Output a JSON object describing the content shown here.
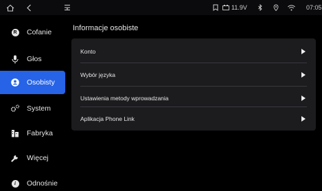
{
  "status_bar": {
    "home_icon": "home-icon",
    "back_icon": "back-icon",
    "menu_icon": "menu-icon",
    "voltage": "11.9V",
    "time": "07:05"
  },
  "sidebar": {
    "items": [
      {
        "label": "Cofanie",
        "icon": "reverse-icon",
        "active": false
      },
      {
        "label": "Głos",
        "icon": "microphone-icon",
        "active": false
      },
      {
        "label": "Osobisty",
        "icon": "user-icon",
        "active": true
      },
      {
        "label": "System",
        "icon": "gears-icon",
        "active": false
      },
      {
        "label": "Fabryka",
        "icon": "factory-icon",
        "active": false
      },
      {
        "label": "Więcej",
        "icon": "wrench-icon",
        "active": false
      },
      {
        "label": "Odnośnie",
        "icon": "info-icon",
        "active": false
      }
    ]
  },
  "main": {
    "title": "Informacje osobiste",
    "rows": [
      {
        "label": "Konto"
      },
      {
        "label": "Wybór języka"
      },
      {
        "label": "Ustawienia metody wprowadzania"
      },
      {
        "label": "Aplikacja Phone Link"
      }
    ]
  },
  "colors": {
    "accent": "#2663e6",
    "panel": "#1c1c1f",
    "background": "#000000"
  }
}
